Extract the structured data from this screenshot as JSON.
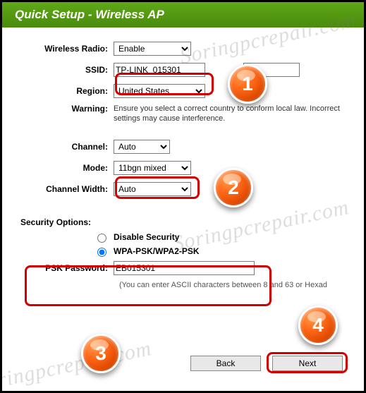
{
  "title": "Quick Setup - Wireless AP",
  "watermark": "Soringpcrepair.com",
  "labels": {
    "wireless_radio": "Wireless Radio:",
    "ssid": "SSID:",
    "region": "Region:",
    "warning": "Warning:",
    "channel": "Channel:",
    "mode": "Mode:",
    "channel_width": "Channel Width:",
    "security_options": "Security Options:",
    "psk_password": "PSK Password:"
  },
  "values": {
    "wireless_radio": "Enable",
    "ssid": "TP-LINK_015301",
    "region": "United States",
    "channel": "Auto",
    "mode": "11bgn mixed",
    "channel_width": "Auto",
    "psk_password": "EB015301"
  },
  "warning_text": "Ensure you select a correct country to conform local law. Incorrect settings may cause interference.",
  "security": {
    "disable": "Disable Security",
    "wpa": "WPA-PSK/WPA2-PSK",
    "selected": "wpa"
  },
  "hint": "(You can enter ASCII characters between 8 and 63 or Hexad",
  "buttons": {
    "back": "Back",
    "next": "Next"
  },
  "badges": {
    "b1": "1",
    "b2": "2",
    "b3": "3",
    "b4": "4"
  }
}
